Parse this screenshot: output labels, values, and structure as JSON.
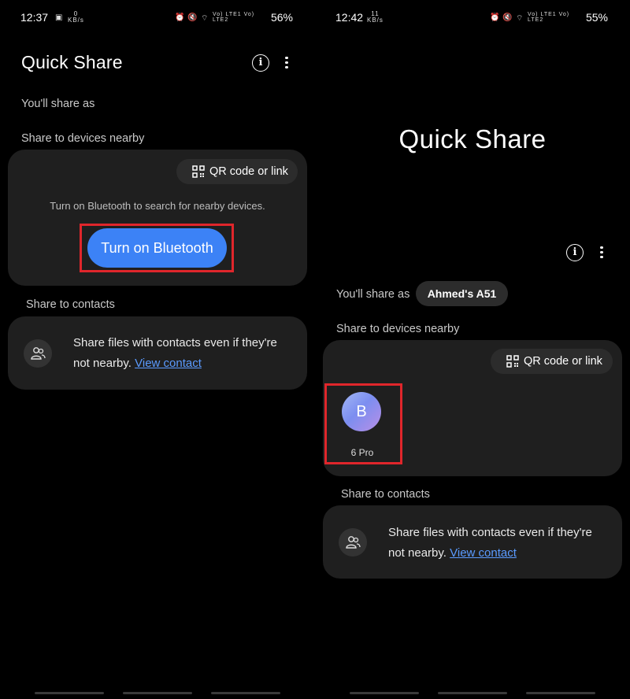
{
  "left": {
    "status": {
      "time": "12:37",
      "net_speed": "0",
      "net_unit": "KB/s",
      "signal": "Vo) LTE1 Vo) LTE2",
      "battery": "56%"
    },
    "title": "Quick Share",
    "share_as_label": "You'll share as",
    "nearby_label": "Share to devices nearby",
    "qr_label": "QR code or link",
    "bluetooth_hint": "Turn on Bluetooth to search for nearby devices.",
    "bluetooth_button": "Turn on Bluetooth",
    "contacts_label": "Share to contacts",
    "contacts_text_1": "Share files with contacts even if they're",
    "contacts_text_2": "not nearby.",
    "view_contact": "View contact"
  },
  "right": {
    "status": {
      "time": "12:42",
      "net_speed": "11",
      "net_unit": "KB/s",
      "signal": "Vo) LTE1 Vo) LTE2",
      "battery": "55%"
    },
    "title": "Quick Share",
    "share_as_label": "You'll share as",
    "device_name": "Ahmed's A51",
    "nearby_label": "Share to devices nearby",
    "qr_label": "QR code or link",
    "nearby_device": {
      "initial": "B",
      "name": "6 Pro"
    },
    "contacts_label": "Share to contacts",
    "contacts_text_1": "Share files with contacts even if they're",
    "contacts_text_2": "not nearby.",
    "view_contact": "View contact"
  },
  "colors": {
    "accent": "#3c82f6",
    "highlight": "#e0262b",
    "card": "#1f1f1f",
    "link": "#5b9bff"
  }
}
